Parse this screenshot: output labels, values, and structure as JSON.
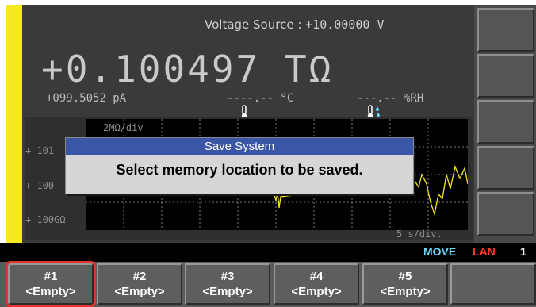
{
  "source": {
    "label": "Voltage Source :",
    "value": "+10.00000  V"
  },
  "reading": {
    "main": "+0.100497 TΩ"
  },
  "sub": {
    "current": "+099.5052 pA",
    "temperature": "----.-- °C",
    "humidity": "---.-- %RH"
  },
  "graph": {
    "y_labels": [
      "+ 101",
      "+ 100",
      "+ 100GΩ"
    ],
    "division_label": "2MΩ/div",
    "time_label": "5 s/div."
  },
  "dialog": {
    "title": "Save System",
    "message": "Select memory location to be saved."
  },
  "status": {
    "move": "MOVE",
    "lan": "LAN",
    "number": "1"
  },
  "memory_keys": [
    {
      "slot": "#1",
      "state": "<Empty>"
    },
    {
      "slot": "#2",
      "state": "<Empty>"
    },
    {
      "slot": "#3",
      "state": "<Empty>"
    },
    {
      "slot": "#4",
      "state": "<Empty>"
    },
    {
      "slot": "#5",
      "state": "<Empty>"
    }
  ],
  "colors": {
    "accent_yellow": "#f6e821",
    "dialog_title": "#3b56a6",
    "highlight": "#e0342c",
    "trace": "#f5e42a"
  }
}
